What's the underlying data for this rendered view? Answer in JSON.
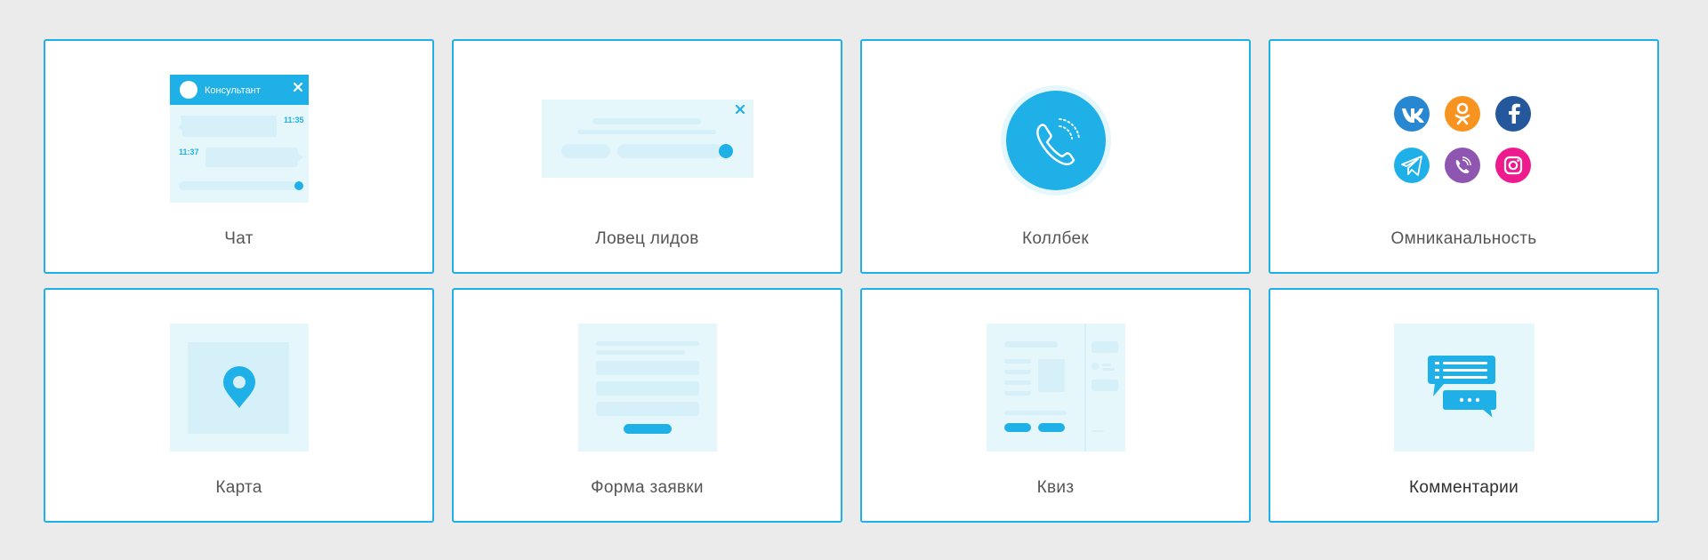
{
  "cards": [
    {
      "label": "Чат",
      "icon": "chat-widget-icon",
      "chat": {
        "title": "Консультант",
        "time1": "11:35",
        "time2": "11:37"
      }
    },
    {
      "label": "Ловец лидов",
      "icon": "lead-catcher-popup-icon"
    },
    {
      "label": "Коллбек",
      "icon": "phone-icon"
    },
    {
      "label": "Омниканальность",
      "icon": "social-networks-icon",
      "networks": [
        {
          "name": "vk-icon",
          "color": "#2787d1"
        },
        {
          "name": "odnoklassniki-icon",
          "color": "#f7931e"
        },
        {
          "name": "facebook-icon",
          "color": "#25579d"
        },
        {
          "name": "telegram-icon",
          "color": "#1fb0e8"
        },
        {
          "name": "viber-icon",
          "color": "#8e56b0"
        },
        {
          "name": "instagram-icon",
          "color": "#ee1b8f"
        }
      ]
    },
    {
      "label": "Карта",
      "icon": "map-pin-icon"
    },
    {
      "label": "Форма заявки",
      "icon": "request-form-icon"
    },
    {
      "label": "Квиз",
      "icon": "quiz-icon"
    },
    {
      "label": "Комментарии",
      "icon": "comments-icon"
    }
  ],
  "colors": {
    "accent": "#1fb0e8",
    "light": "#e6f7fc",
    "mid": "#d5f0f8"
  }
}
